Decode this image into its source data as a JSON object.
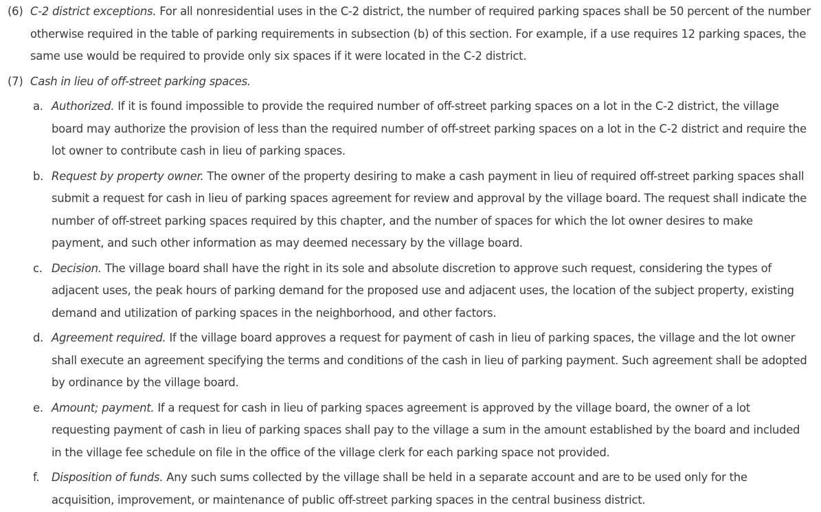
{
  "sections": {
    "s6": {
      "marker": "(6)",
      "heading": "C-2 district exceptions.",
      "text": " For all nonresidential uses in the C-2 district, the number of required parking spaces shall be 50 percent of the number otherwise required in the table of parking requirements in subsection (b) of this section. For example, if a use requires 12 parking spaces, the same use would be required to provide only six spaces if it were located in the C-2 district."
    },
    "s7": {
      "marker": "(7)",
      "heading": "Cash in lieu of off-street parking spaces.",
      "items": [
        {
          "marker": "a.",
          "heading": "Authorized.",
          "text": " If it is found impossible to provide the required number of off-street parking spaces on a lot in the C-2 district, the village board may authorize the provision of less than the required number of off-street parking spaces on a lot in the C-2 district and require the lot owner to contribute cash in lieu of parking spaces."
        },
        {
          "marker": "b.",
          "heading": "Request by property owner.",
          "text": " The owner of the property desiring to make a cash payment in lieu of required off-street parking spaces shall submit a request for cash in lieu of parking spaces agreement for review and approval by the village board. The request shall indicate the number of off-street parking spaces required by this chapter, and the number of spaces for which the lot owner desires to make payment, and such other information as may deemed necessary by the village board."
        },
        {
          "marker": "c.",
          "heading": "Decision.",
          "text": " The village board shall have the right in its sole and absolute discretion to approve such request, considering the types of adjacent uses, the peak hours of parking demand for the proposed use and adjacent uses, the location of the subject property, existing demand and utilization of parking spaces in the neighborhood, and other factors."
        },
        {
          "marker": "d.",
          "heading": "Agreement required.",
          "text": " If the village board approves a request for payment of cash in lieu of parking spaces, the village and the lot owner shall execute an agreement specifying the terms and conditions of the cash in lieu of parking payment. Such agreement shall be adopted by ordinance by the village board."
        },
        {
          "marker": "e.",
          "heading": "Amount; payment.",
          "text": " If a request for cash in lieu of parking spaces agreement is approved by the village board, the owner of a lot requesting payment of cash in lieu of parking spaces shall pay to the village a sum in the amount established by the board and included in the village fee schedule on file in the office of the village clerk for each parking space not provided."
        },
        {
          "marker": "f.",
          "heading": "Disposition of funds.",
          "text": " Any such sums collected by the village shall be held in a separate account and are to be used only for the acquisition, improvement, or maintenance of public off-street parking spaces in the central business district."
        }
      ]
    }
  }
}
